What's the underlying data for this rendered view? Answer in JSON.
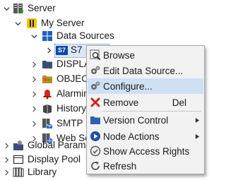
{
  "tree": {
    "server": "Server",
    "my_server": "My Server",
    "data_sources": "Data Sources",
    "s7_badge": "S7",
    "s7_label": "S7",
    "display": "DISPLAY",
    "objects": "OBJECTS",
    "alarming": "Alarming",
    "history": "History A",
    "smtp": "SMTP Se",
    "web": "Web Ser",
    "global_params": "Global Paramete",
    "display_pool": "Display Pool",
    "library": "Library"
  },
  "context_menu": {
    "browse": "Browse",
    "edit_data_source": "Edit Data Source...",
    "configure": "Configure...",
    "remove": "Remove",
    "remove_shortcut": "Del",
    "version_control": "Version Control",
    "node_actions": "Node Actions",
    "show_access_rights": "Show Access Rights",
    "refresh": "Refresh"
  },
  "colors": {
    "selection": "#dbe7f7",
    "menu_highlight": "#cfe0f4",
    "accent_blue": "#0a4aa8",
    "remove_red": "#d02020",
    "folder_yellow": "#e8b923"
  }
}
